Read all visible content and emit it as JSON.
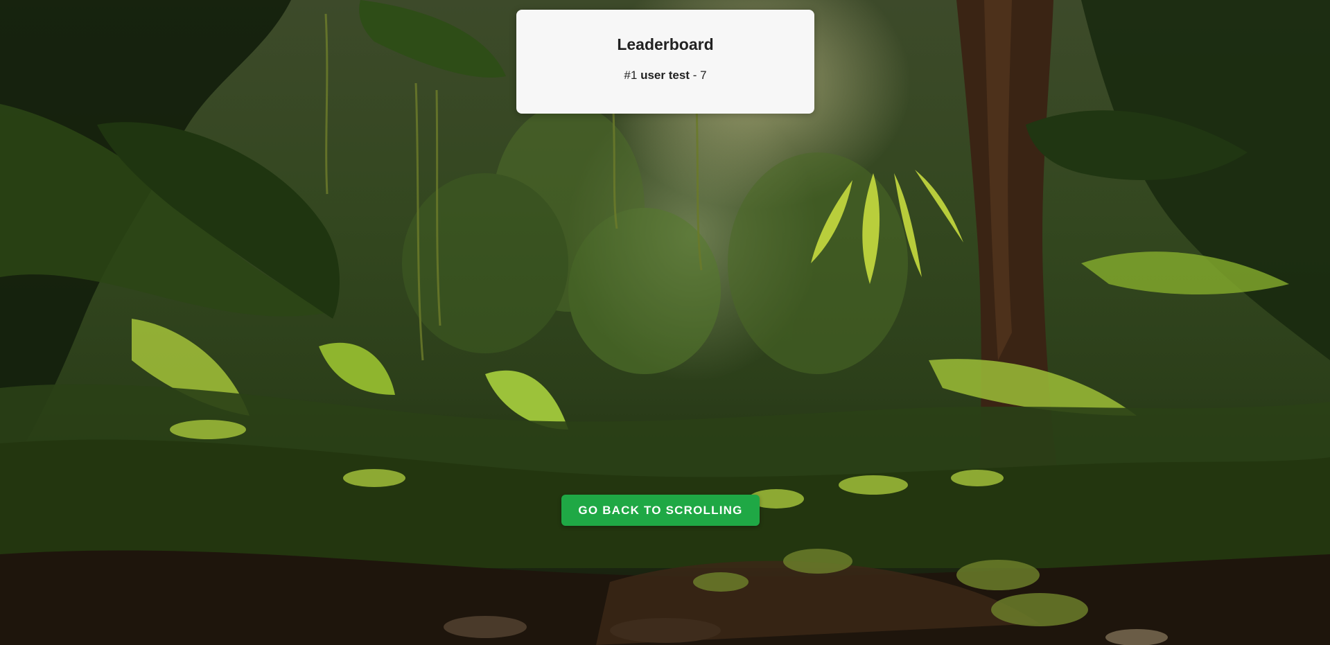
{
  "background": {
    "description_icon": "jungle-background",
    "colors": {
      "canopy_dark": "#1a2a10",
      "foliage": "#4e7a1e",
      "foliage_light": "#b9d23c",
      "haze": "#e6e0b4",
      "trunk": "#3a2414",
      "ground": "#2b1c10"
    }
  },
  "leaderboard": {
    "title": "Leaderboard",
    "entries": [
      {
        "rank": "#1",
        "user": "user test",
        "separator": "-",
        "score": "7"
      }
    ]
  },
  "actions": {
    "back_label": "GO BACK TO SCROLLING",
    "back_color": "#1fa845"
  }
}
